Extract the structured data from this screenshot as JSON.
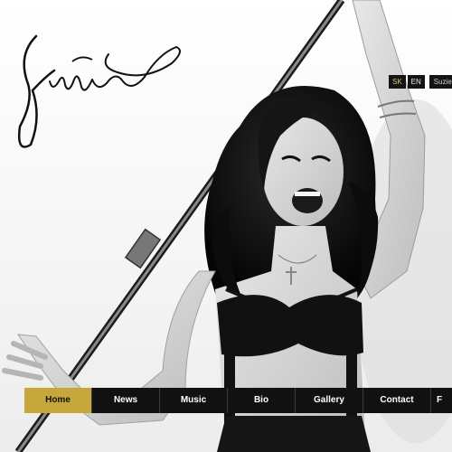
{
  "brand": {
    "logo_text": "Suzie",
    "accent_color": "#c6a83a"
  },
  "languages": {
    "items": [
      {
        "label": "SK",
        "active": true
      },
      {
        "label": "EN",
        "active": false
      }
    ],
    "site_name": "Suzie"
  },
  "nav": {
    "items": [
      {
        "label": "Home",
        "active": true
      },
      {
        "label": "News",
        "active": false
      },
      {
        "label": "Music",
        "active": false
      },
      {
        "label": "Bio",
        "active": false
      },
      {
        "label": "Gallery",
        "active": false
      },
      {
        "label": "Contact",
        "active": false
      },
      {
        "label": "F",
        "active": false
      }
    ]
  },
  "hero": {
    "photo": "black-and-white photo of singer holding a pole"
  }
}
